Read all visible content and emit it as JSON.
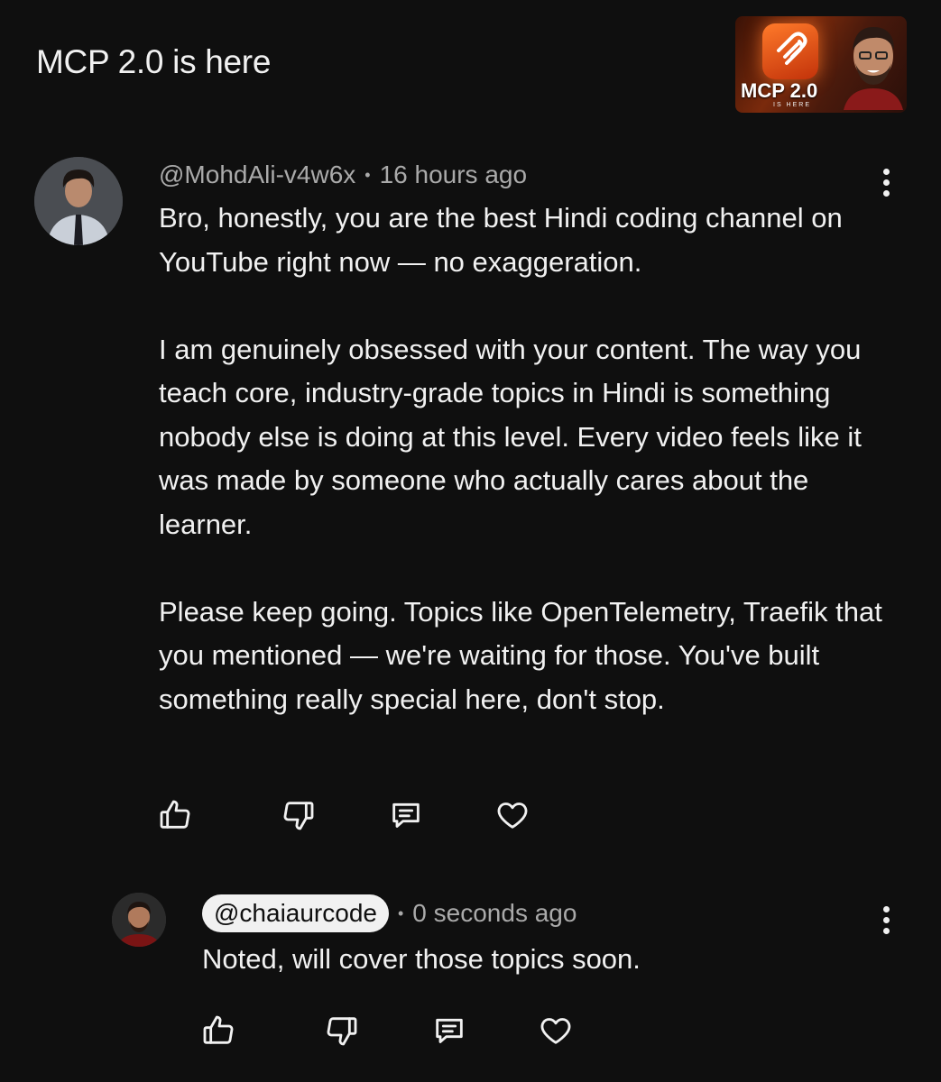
{
  "video": {
    "title": "MCP 2.0 is here",
    "thumbnail_text": "MCP 2.0",
    "thumbnail_subtext": "IS HERE"
  },
  "comment": {
    "author": "@MohdAli-v4w6x",
    "separator": "•",
    "time": "16 hours ago",
    "paragraphs": [
      "Bro, honestly, you are the best Hindi coding channel on YouTube right now — no exaggeration.",
      "I am genuinely obsessed with your content. The way you teach core, industry-grade topics in Hindi is something nobody else is doing at this level. Every video feels like it was made by someone who actually cares about the learner.",
      "Please keep going. Topics like OpenTelemetry, Traefik that you mentioned — we're waiting for those. You've built something really special here, don't stop."
    ],
    "actions": [
      "like-icon",
      "dislike-icon",
      "reply-icon",
      "heart-icon"
    ]
  },
  "reply": {
    "author": "@chaiaurcode",
    "separator": "•",
    "time": "0 seconds ago",
    "text": "Noted, will cover those topics soon.",
    "actions": [
      "like-icon",
      "dislike-icon",
      "reply-icon",
      "heart-icon"
    ]
  },
  "colors": {
    "background": "#0f0f0f",
    "text": "#f1f1f1",
    "meta": "#aaaaaa"
  }
}
